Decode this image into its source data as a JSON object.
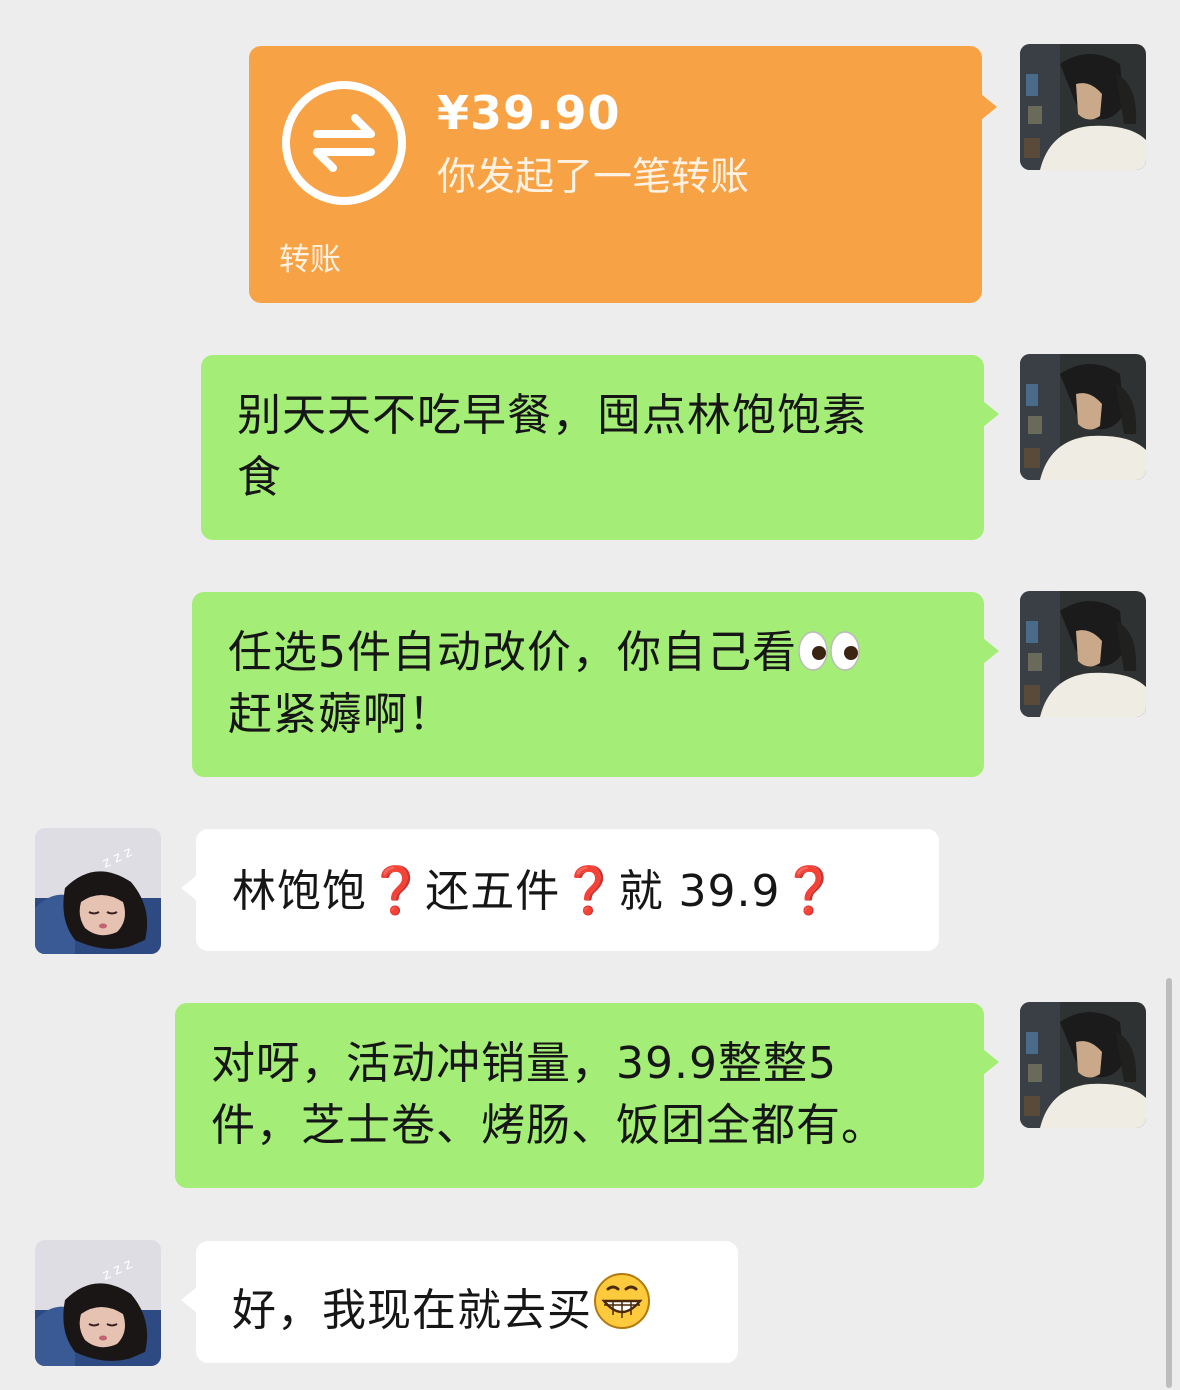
{
  "colors": {
    "background": "#ededed",
    "self_bubble": "#a4ed76",
    "other_bubble": "#ffffff",
    "transfer_card": "#f8a246",
    "question_mark": "#e3262d"
  },
  "avatars": {
    "self": "boy-portrait-avatar",
    "other": "sleeping-girl-avatar"
  },
  "transfer": {
    "amount": "¥39.90",
    "description": "你发起了一笔转账",
    "label": "转账",
    "icon": "transfer-arrows-icon"
  },
  "messages": [
    {
      "sender": "self",
      "line1": "别天天不吃早餐，囤点林饱饱素",
      "line2": "食"
    },
    {
      "sender": "self",
      "line1": "任选5件自动改价，你自己看",
      "line1_emoji": "eyes-emoji",
      "line2": "赶紧薅啊！"
    },
    {
      "sender": "other",
      "segments": [
        "林饱饱",
        "❓",
        "还五件",
        "❓",
        "就 39.9",
        "❓"
      ]
    },
    {
      "sender": "self",
      "line1": "对呀，活动冲销量，39.9整整5",
      "line2": "件，芝士卷、烤肠、饭团全都有。"
    },
    {
      "sender": "other",
      "text": "好，我现在就去买",
      "emoji": "grinning-face-emoji"
    }
  ]
}
